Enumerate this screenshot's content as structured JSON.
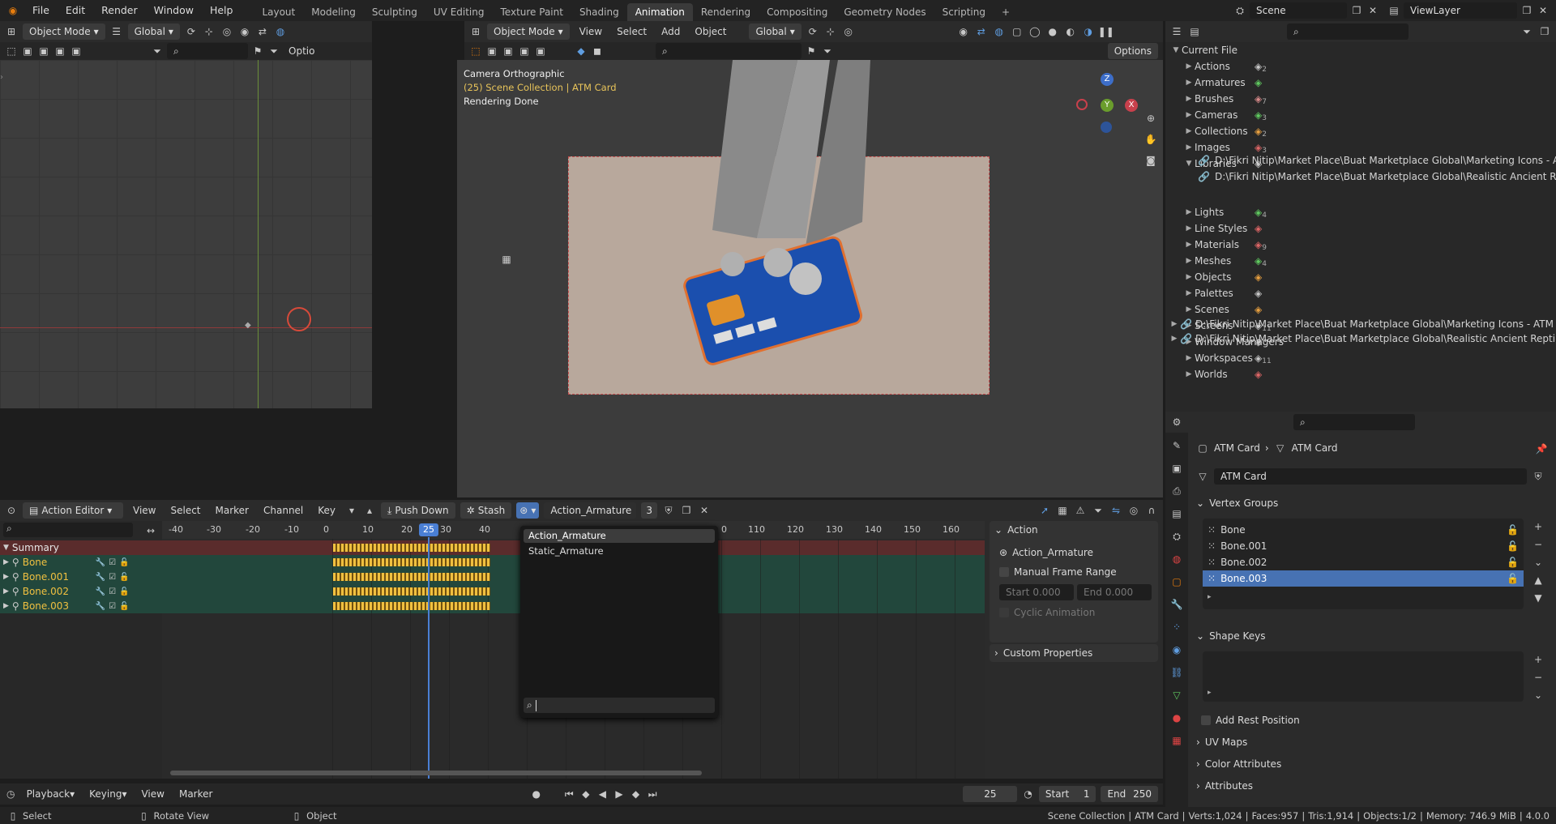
{
  "topbar": {
    "menus": [
      "File",
      "Edit",
      "Render",
      "Window",
      "Help"
    ],
    "workspaces": [
      "Layout",
      "Modeling",
      "Sculpting",
      "UV Editing",
      "Texture Paint",
      "Shading",
      "Animation",
      "Rendering",
      "Compositing",
      "Geometry Nodes",
      "Scripting"
    ],
    "active_workspace": "Animation",
    "add_tab": "+",
    "scene": "Scene",
    "view_layer": "ViewLayer"
  },
  "left_view": {
    "mode": "Object Mode",
    "orientation": "Global",
    "options": "Optio"
  },
  "main_view": {
    "mode": "Object Mode",
    "menus": [
      "View",
      "Select",
      "Add",
      "Object"
    ],
    "orientation": "Global",
    "options": "Options",
    "overlay_title": "Camera Orthographic",
    "overlay_collection": "(25) Scene Collection | ATM Card",
    "overlay_status": "Rendering Done",
    "gizmo_x": "X",
    "gizmo_y": "Y",
    "gizmo_z": "Z"
  },
  "outliner": {
    "root": "Current File",
    "items": [
      {
        "label": "Actions",
        "count": "2"
      },
      {
        "label": "Armatures",
        "count": ""
      },
      {
        "label": "Brushes",
        "count": "7"
      },
      {
        "label": "Cameras",
        "count": "3"
      },
      {
        "label": "Collections",
        "count": "2"
      },
      {
        "label": "Images",
        "count": "3"
      },
      {
        "label": "Libraries",
        "count": ""
      },
      {
        "label": "Lights",
        "count": "4"
      },
      {
        "label": "Line Styles",
        "count": ""
      },
      {
        "label": "Materials",
        "count": "9"
      },
      {
        "label": "Meshes",
        "count": "4"
      },
      {
        "label": "Objects",
        "count": ""
      },
      {
        "label": "Palettes",
        "count": ""
      },
      {
        "label": "Scenes",
        "count": ""
      },
      {
        "label": "Screens",
        "count": "11"
      },
      {
        "label": "Window Managers",
        "count": ""
      },
      {
        "label": "Workspaces",
        "count": "11"
      },
      {
        "label": "Worlds",
        "count": ""
      }
    ],
    "libraries": [
      "D:\\Fikri Nitip\\Market Place\\Buat Marketplace Global\\Marketing Icons - ATM C",
      "D:\\Fikri Nitip\\Market Place\\Buat Marketplace Global\\Realistic Ancient Reptilia"
    ],
    "bottom_paths": [
      "D:\\Fikri Nitip\\Market Place\\Buat Marketplace Global\\Marketing Icons - ATM Card\\Ble",
      "D:\\Fikri Nitip\\Market Place\\Buat Marketplace Global\\Realistic Ancient Reptilians Fos"
    ]
  },
  "properties": {
    "breadcrumb_object": "ATM Card",
    "breadcrumb_data": "ATM Card",
    "mesh_name": "ATM Card",
    "vertex_groups_title": "Vertex Groups",
    "vertex_groups": [
      "Bone",
      "Bone.001",
      "Bone.002",
      "Bone.003"
    ],
    "selected_group": "Bone.003",
    "shape_keys_title": "Shape Keys",
    "add_rest_position": "Add Rest Position",
    "uv_maps": "UV Maps",
    "color_attributes": "Color Attributes",
    "attributes": "Attributes"
  },
  "action_editor": {
    "editor": "Action Editor",
    "menus": [
      "View",
      "Select",
      "Marker",
      "Channel",
      "Key"
    ],
    "push_down": "Push Down",
    "stash": "Stash",
    "action_name": "Action_Armature",
    "users": "3",
    "channels": [
      {
        "label": "Summary",
        "kind": "summary"
      },
      {
        "label": "Bone",
        "kind": "bone"
      },
      {
        "label": "Bone.001",
        "kind": "bone"
      },
      {
        "label": "Bone.002",
        "kind": "bone"
      },
      {
        "label": "Bone.003",
        "kind": "bone"
      }
    ],
    "ticks_left": [
      "-40",
      "-30",
      "-20",
      "-10",
      "0",
      "10",
      "20",
      "30",
      "40"
    ],
    "ticks_right": [
      "0",
      "110",
      "120",
      "130",
      "140",
      "150",
      "160"
    ],
    "current_frame": "25",
    "dropdown": {
      "items": [
        "Action_Armature",
        "Static_Armature"
      ],
      "search_value": ""
    },
    "panel": {
      "title": "Action",
      "action": "Action_Armature",
      "manual_range": "Manual Frame Range",
      "start_label": "Start",
      "start_value": "0.000",
      "end_label": "End",
      "end_value": "0.000",
      "cyclic": "Cyclic Animation",
      "custom": "Custom Properties"
    }
  },
  "timeline": {
    "menus": [
      "Playback",
      "Keying",
      "View",
      "Marker"
    ],
    "frame": "25",
    "start_label": "Start",
    "start_value": "1",
    "end_label": "End",
    "end_value": "250"
  },
  "statusbar": {
    "select": "Select",
    "rotate": "Rotate View",
    "object": "Object",
    "collection": "Scene Collection",
    "active": "ATM Card",
    "verts": "Verts:1,024",
    "faces": "Faces:957",
    "tris": "Tris:1,914",
    "objects": "Objects:1/2",
    "memory": "Memory: 746.9 MiB",
    "version": "4.0.0"
  },
  "colors": {
    "accent": "#4772b3",
    "active_tab": "#3a3a3a",
    "keyframe": "#f0c040",
    "playhead": "#4a7fd4",
    "selected_channel": "#f0c040"
  }
}
